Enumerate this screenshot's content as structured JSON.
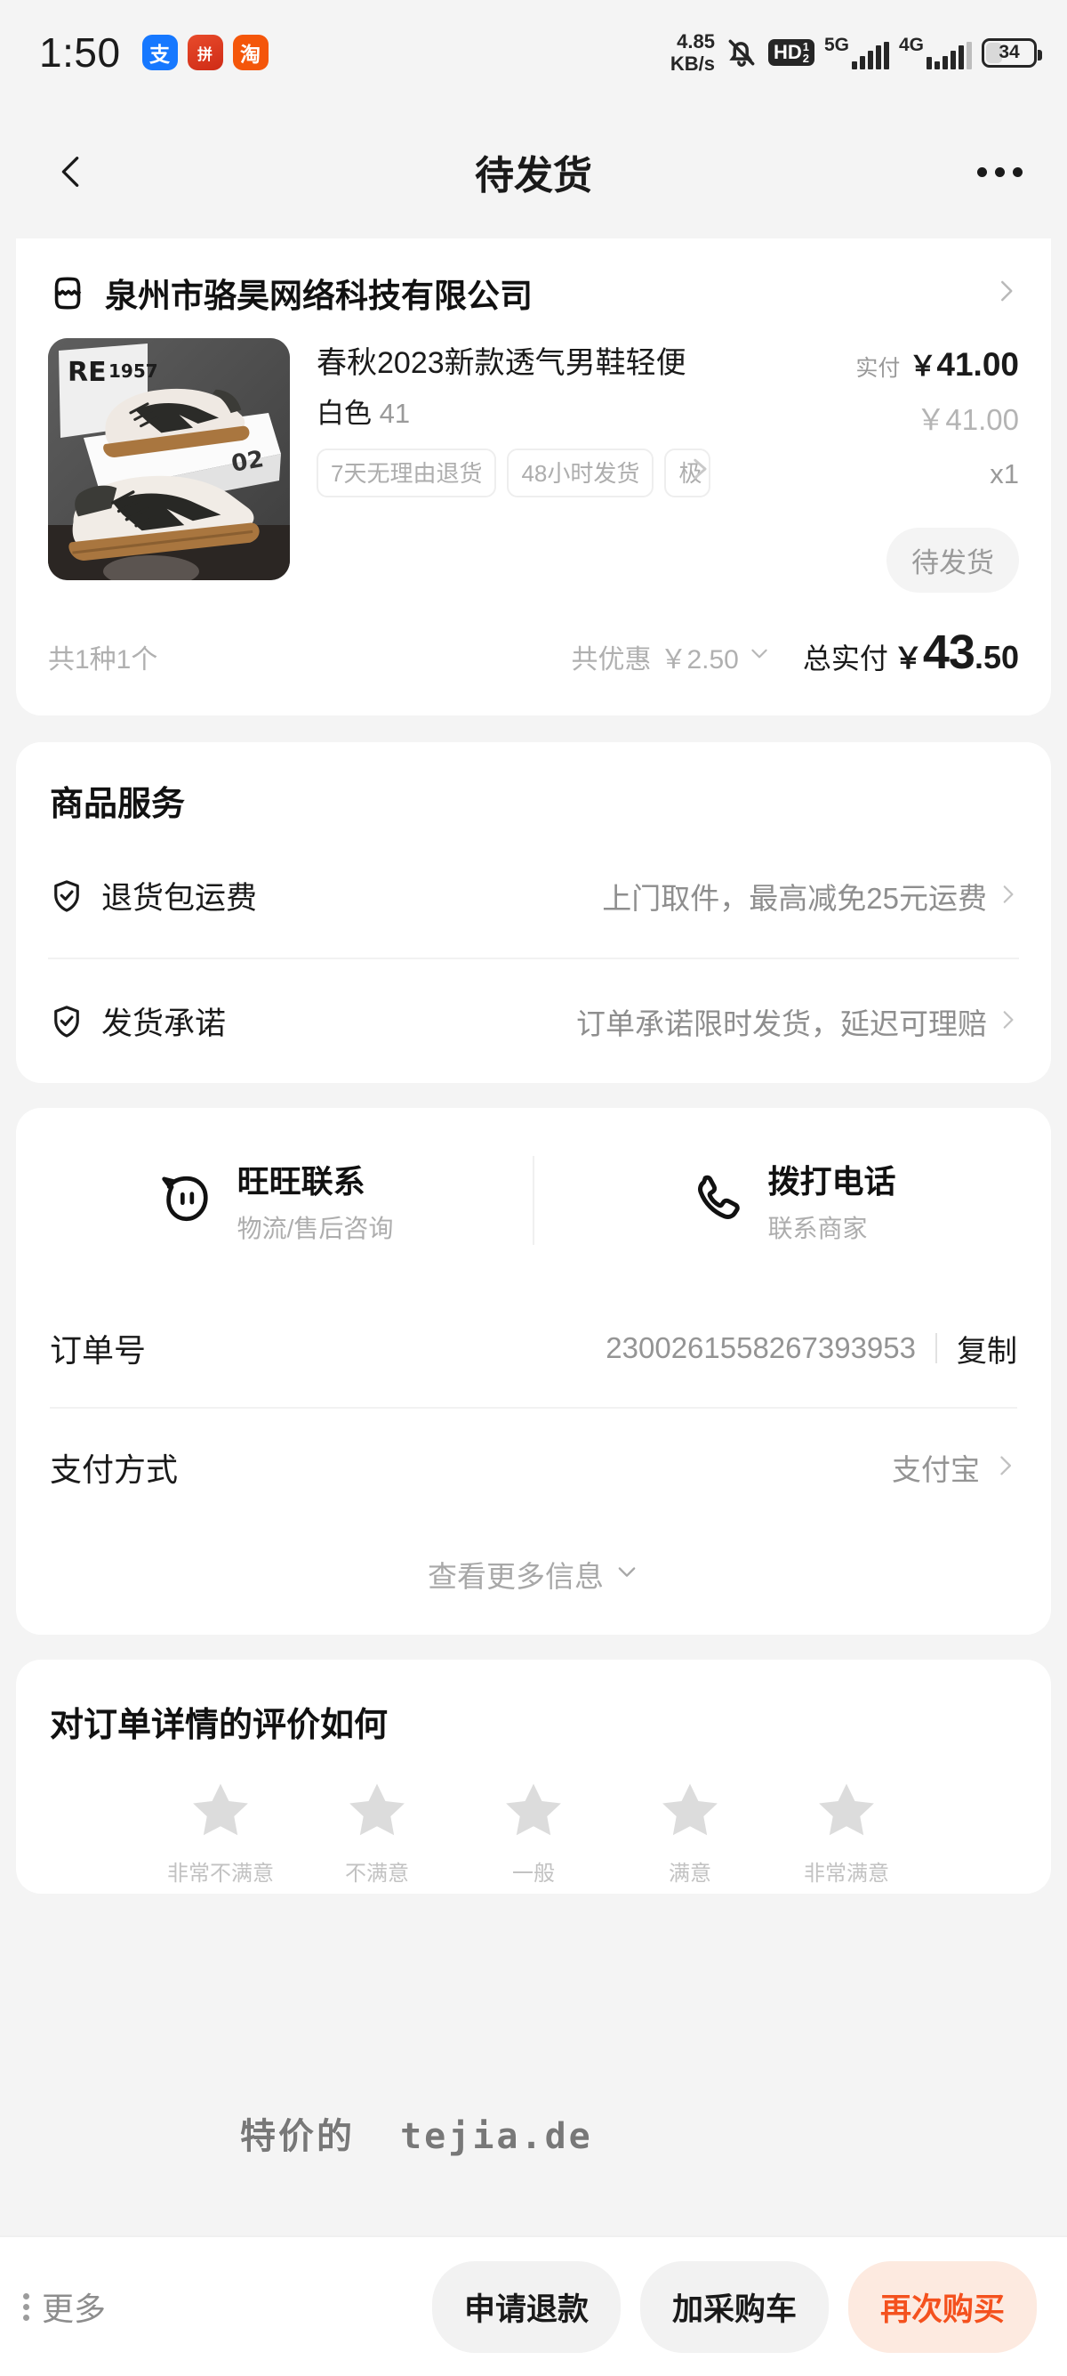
{
  "statusbar": {
    "time": "1:50",
    "apps": [
      {
        "name": "alipay-app-icon",
        "glyph": "支"
      },
      {
        "name": "pinduoduo-app-icon",
        "glyph": "拼"
      },
      {
        "name": "taobao-app-icon",
        "glyph": "淘"
      }
    ],
    "network_speed": "4.85",
    "network_speed_unit": "KB/s",
    "mute_icon": "bell-muted-icon",
    "hd_label": "HD",
    "hd_sup": "1",
    "hd_sub": "2",
    "sim1_label": "5G",
    "sim2_label": "4G",
    "battery_level": "34"
  },
  "navbar": {
    "back_icon": "chevron-left-icon",
    "title": "待发货",
    "more_icon": "more-horizontal-icon"
  },
  "shop": {
    "icon": "shop-icon",
    "name": "泉州市骆昊网络科技有限公司",
    "arrow": "chevron-right-icon"
  },
  "product": {
    "image_alt": "white-black-sneakers-photo",
    "box_text": "1957",
    "title": "春秋2023新款透气男鞋轻便",
    "spec_color": "白色",
    "spec_size": "41",
    "tags": [
      "7天无理由退货",
      "48小时发货",
      "极"
    ],
    "paid_label": "实付",
    "paid_currency": "￥",
    "paid_price": "41.00",
    "original_price": "￥41.00",
    "quantity": "x1",
    "status": "待发货"
  },
  "totals": {
    "count_text": "共1种1个",
    "discount_label": "共优惠",
    "discount_value": "￥2.50",
    "discount_chevron": "chevron-down-icon",
    "total_label": "总实付",
    "total_currency": "￥",
    "total_int": "43",
    "total_dec": ".50"
  },
  "services": {
    "title": "商品服务",
    "items": [
      {
        "icon": "shield-check-icon",
        "name": "退货包运费",
        "value": "上门取件，最高减免25元运费",
        "arrow": "chevron-right-icon"
      },
      {
        "icon": "shield-check-icon",
        "name": "发货承诺",
        "value": "订单承诺限时发货，延迟可理赔",
        "arrow": "chevron-right-icon"
      }
    ]
  },
  "contact": {
    "items": [
      {
        "icon": "wangwang-icon",
        "title": "旺旺联系",
        "subtitle": "物流/售后咨询"
      },
      {
        "icon": "phone-icon",
        "title": "拨打电话",
        "subtitle": "联系商家"
      }
    ]
  },
  "order_info": {
    "rows": [
      {
        "key": "订单号",
        "value": "2300261558267393953",
        "action": "复制"
      },
      {
        "key": "支付方式",
        "value": "支付宝",
        "arrow": "chevron-right-icon"
      }
    ],
    "more_label": "查看更多信息",
    "more_chevron": "chevron-down-icon"
  },
  "rating": {
    "title": "对订单详情的评价如何",
    "star_icon": "star-icon",
    "star_color": "#dcdcdc",
    "labels": [
      "非常不满意",
      "不满意",
      "一般",
      "满意",
      "非常满意"
    ]
  },
  "watermark": {
    "cn": "特价的",
    "en": "tejia.de"
  },
  "bottombar": {
    "more_icon": "more-vertical-icon",
    "more_label": "更多",
    "buttons": [
      {
        "label": "申请退款",
        "primary": false
      },
      {
        "label": "加采购车",
        "primary": false
      },
      {
        "label": "再次购买",
        "primary": true
      }
    ],
    "primary_color": "#f4511e",
    "primary_bg": "#fdeae0"
  }
}
